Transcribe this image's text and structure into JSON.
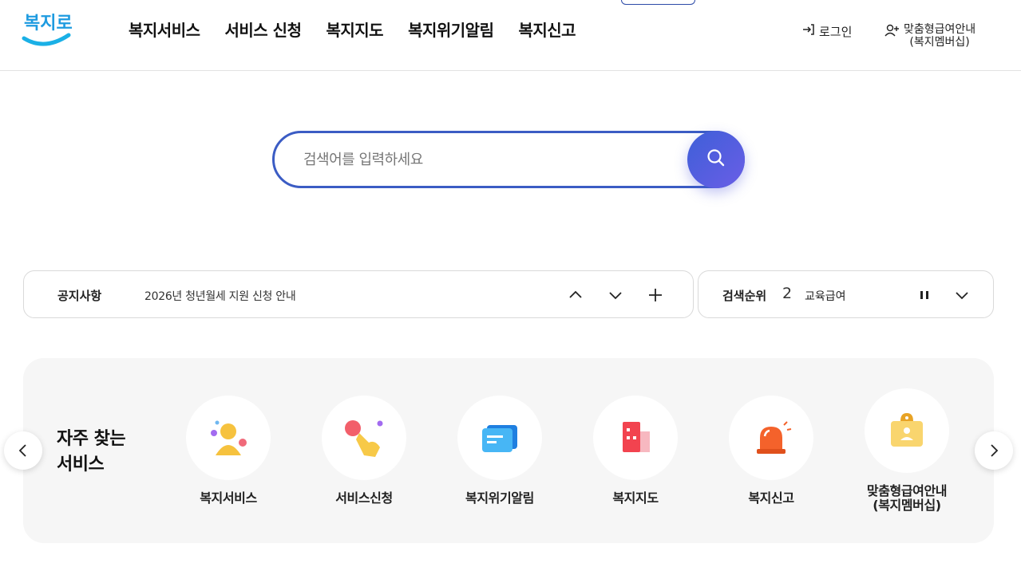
{
  "header": {
    "logo_text": "복지로",
    "nav": [
      "복지서비스",
      "서비스 신청",
      "복지지도",
      "복지위기알림",
      "복지신고"
    ],
    "login_label": "로그인",
    "member_label_line1": "맞춤형급여안내",
    "member_label_line2": "(복지멤버십)"
  },
  "search": {
    "placeholder": "검색어를 입력하세요",
    "value": ""
  },
  "notice": {
    "label": "공지사항",
    "text": "2026년 청년월세 지원 신청 안내"
  },
  "rank": {
    "label": "검색순위",
    "number": "2",
    "text": "교육급여"
  },
  "frequent": {
    "title_line1": "자주 찾는",
    "title_line2": "서비스",
    "items": [
      {
        "label": "복지서비스",
        "icon": "person-icon"
      },
      {
        "label": "서비스신청",
        "icon": "hand-tap-icon"
      },
      {
        "label": "복지위기알림",
        "icon": "message-icon"
      },
      {
        "label": "복지지도",
        "icon": "building-icon"
      },
      {
        "label": "복지신고",
        "icon": "siren-icon"
      },
      {
        "label": "맞춤형급여안내",
        "label2": "(복지멤버십)",
        "icon": "membership-card-icon"
      }
    ]
  },
  "colors": {
    "accent": "#3b5cc4",
    "search_button": "#5a5fe0",
    "section_bg": "#f6f6f6"
  }
}
